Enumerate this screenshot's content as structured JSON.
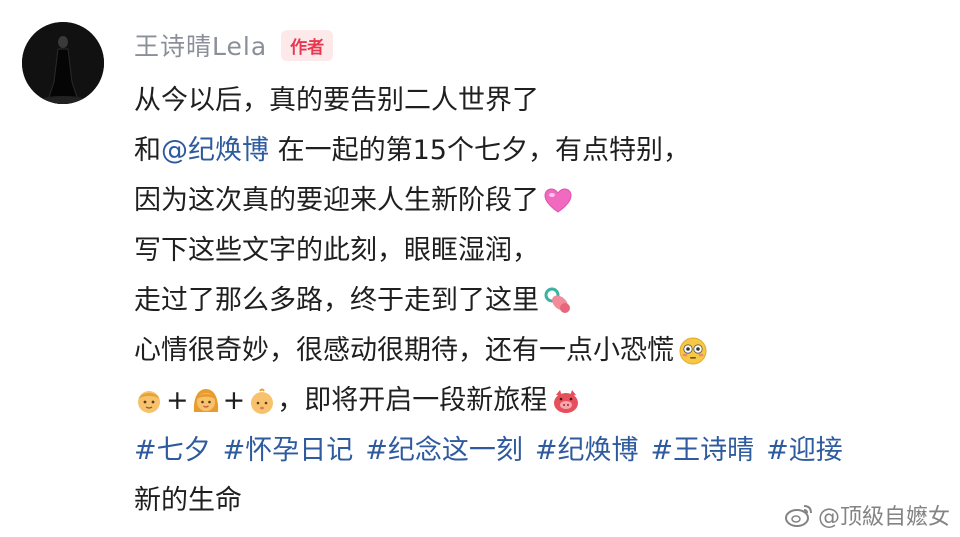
{
  "post": {
    "username": "王诗晴Lela",
    "author_badge": "作者",
    "lines": {
      "l1": "从今以后，真的要告别二人世界了",
      "l2_pre": "和",
      "l2_mention": "@纪焕博",
      "l2_post": " 在一起的第15个七夕，有点特别，",
      "l3": "因为这次真的要迎来人生新阶段了",
      "l4": "写下这些文字的此刻，眼眶湿润，",
      "l5": "走过了那么多路，终于走到了这里",
      "l6": "心情很奇妙，很感动很期待，还有一点小恐慌",
      "l7_plus1": "+",
      "l7_plus2": "+",
      "l7_text": "，即将开启一段新旅程",
      "l9": "新的生命"
    },
    "hashtags": [
      "#七夕",
      "#怀孕日记",
      "#纪念这一刻",
      "#纪焕博",
      "#王诗晴",
      "#迎接"
    ],
    "emojis": {
      "heart": "pink-heart-icon",
      "pacifier": "pacifier-icon",
      "flushed": "flushed-face-icon",
      "man": "man-face-icon",
      "woman": "woman-face-icon",
      "baby": "baby-face-icon",
      "pig": "pig-face-icon"
    }
  },
  "watermark": {
    "text": "@顶級自嬷女"
  },
  "colors": {
    "username": "#8a8f99",
    "badge_text": "#e8384f",
    "badge_bg": "#fde8ea",
    "link": "#2e5a9e",
    "body_text": "#1f1f1f"
  }
}
